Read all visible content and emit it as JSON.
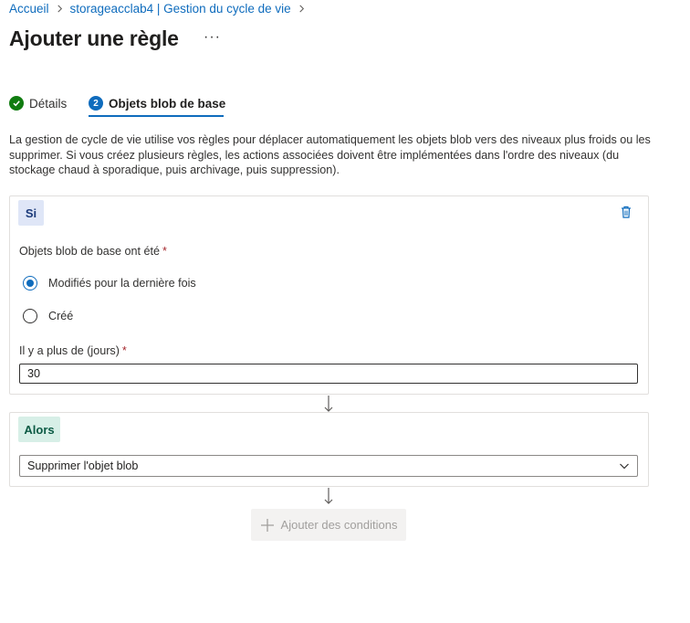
{
  "breadcrumb": {
    "items": [
      "Accueil",
      "storageacclab4 | Gestion du cycle de vie"
    ]
  },
  "page": {
    "title": "Ajouter une règle",
    "more_label": "···"
  },
  "tabs": [
    {
      "label": "Détails",
      "status": "completed"
    },
    {
      "label": "Objets blob de base",
      "number": "2",
      "status": "active"
    }
  ],
  "description": "La gestion de cycle de vie utilise vos règles pour déplacer automatiquement les objets blob vers des niveaux plus froids ou les supprimer. Si vous créez plusieurs règles, les actions associées doivent être implémentées dans l'ordre des niveaux (du stockage chaud à sporadique, puis archivage, puis suppression).",
  "if_block": {
    "badge": "Si",
    "condition_label": "Objets blob de base ont été",
    "required_mark": "*",
    "options": [
      {
        "label": "Modifiés pour la dernière fois",
        "checked": true
      },
      {
        "label": "Créé",
        "checked": false
      }
    ],
    "days_label": "Il y a plus de (jours)",
    "days_value": "30"
  },
  "then_block": {
    "badge": "Alors",
    "action_selected": "Supprimer l'objet blob"
  },
  "add_conditions_label": "Ajouter des conditions",
  "colors": {
    "accent": "#0f6cbd",
    "success": "#107c10",
    "if_badge_bg": "#dfe6f7",
    "then_badge_bg": "#d7efe7"
  }
}
